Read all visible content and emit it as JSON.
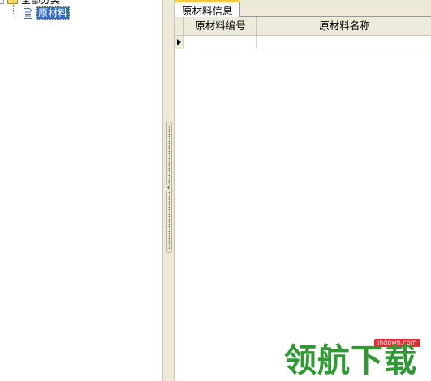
{
  "tree": {
    "root_label": "全部分类",
    "child_label": "原材料"
  },
  "tabs": [
    {
      "label": "原材料信息"
    }
  ],
  "grid": {
    "columns": [
      "原材料编号",
      "原材料名称"
    ],
    "rows": [
      [
        "",
        ""
      ]
    ]
  },
  "watermark": {
    "url": "ihdown.com",
    "text": "领航下载"
  },
  "icons": {
    "root": "folder-icon",
    "child": "document-icon",
    "row_indicator": "row-pointer-icon",
    "splitter_arrow": "chevron-left-icon"
  },
  "colors": {
    "selection": "#316ac5",
    "tab_accent": "#ffc83c",
    "watermark_green": "#2f9a34",
    "watermark_red": "#e8262f"
  }
}
